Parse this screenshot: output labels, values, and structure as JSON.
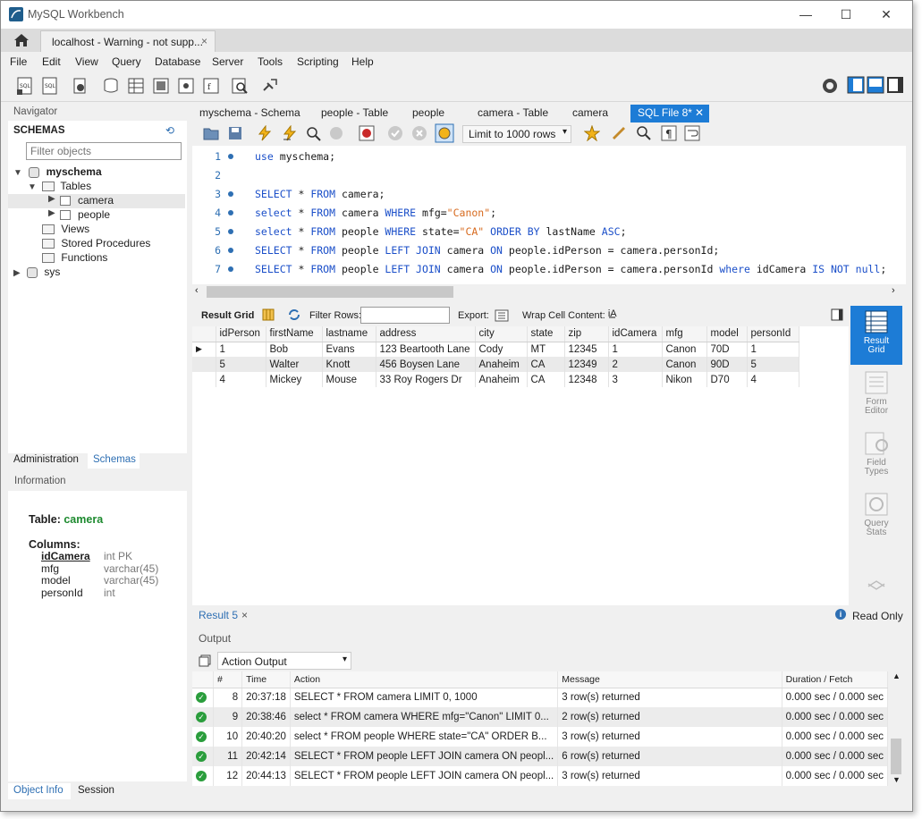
{
  "window": {
    "title": "MySQL Workbench"
  },
  "connection_tab": {
    "label": "localhost - Warning - not supp...",
    "close": "×"
  },
  "menu": [
    "File",
    "Edit",
    "View",
    "Query",
    "Database",
    "Server",
    "Tools",
    "Scripting",
    "Help"
  ],
  "navigator": {
    "title": "Navigator",
    "schemas_label": "SCHEMAS",
    "filter_placeholder": "Filter objects",
    "tree": {
      "schema": "myschema",
      "tables": "Tables",
      "table1": "camera",
      "table2": "people",
      "views": "Views",
      "procs": "Stored Procedures",
      "funcs": "Functions",
      "sys": "sys"
    },
    "tabs": [
      "Administration",
      "Schemas"
    ],
    "information_label": "Information"
  },
  "info": {
    "table_prefix": "Table: ",
    "table_name": "camera",
    "columns_label": "Columns:",
    "columns": [
      {
        "name": "idCamera",
        "type": "int PK"
      },
      {
        "name": "mfg",
        "type": "varchar(45)"
      },
      {
        "name": "model",
        "type": "varchar(45)"
      },
      {
        "name": "personId",
        "type": "int"
      }
    ]
  },
  "bottom_tabs": [
    "Object Info",
    "Session"
  ],
  "editor_tabs": [
    "myschema - Schema",
    "people - Table",
    "people",
    "camera - Table",
    "camera",
    "SQL File 8*"
  ],
  "editor": {
    "limit": "Limit to 1000 rows",
    "line_numbers": [
      "1",
      "2",
      "3",
      "4",
      "5",
      "6",
      "7"
    ]
  },
  "result_bar": {
    "result_grid": "Result Grid",
    "filter_rows": "Filter Rows:",
    "export": "Export:",
    "wrap": "Wrap Cell Content:"
  },
  "grid": {
    "columns": [
      "idPerson",
      "firstName",
      "lastname",
      "address",
      "city",
      "state",
      "zip",
      "idCamera",
      "mfg",
      "model",
      "personId"
    ],
    "rows": [
      [
        "1",
        "Bob",
        "Evans",
        "123 Beartooth Lane",
        "Cody",
        "MT",
        "12345",
        "1",
        "Canon",
        "70D",
        "1"
      ],
      [
        "5",
        "Walter",
        "Knott",
        "456 Boysen Lane",
        "Anaheim",
        "CA",
        "12349",
        "2",
        "Canon",
        "90D",
        "5"
      ],
      [
        "4",
        "Mickey",
        "Mouse",
        "33 Roy Rogers Dr",
        "Anaheim",
        "CA",
        "12348",
        "3",
        "Nikon",
        "D70",
        "4"
      ]
    ]
  },
  "side_panel": {
    "result_grid": [
      "Result",
      "Grid"
    ],
    "form_editor": [
      "Form",
      "Editor"
    ],
    "field_types": [
      "Field",
      "Types"
    ],
    "query_stats": [
      "Query",
      "Stats"
    ]
  },
  "result_tab": {
    "label": "Result 5",
    "close": "×",
    "read_only": "Read Only"
  },
  "output": {
    "title": "Output",
    "mode": "Action Output",
    "columns": [
      "#",
      "Time",
      "Action",
      "Message",
      "Duration / Fetch"
    ],
    "rows": [
      [
        "8",
        "20:37:18",
        "SELECT * FROM camera LIMIT 0, 1000",
        "3 row(s) returned",
        "0.000 sec / 0.000 sec"
      ],
      [
        "9",
        "20:38:46",
        "select * FROM camera WHERE mfg=\"Canon\" LIMIT 0...",
        "2 row(s) returned",
        "0.000 sec / 0.000 sec"
      ],
      [
        "10",
        "20:40:20",
        "select * FROM people WHERE state=\"CA\" ORDER B...",
        "3 row(s) returned",
        "0.000 sec / 0.000 sec"
      ],
      [
        "11",
        "20:42:14",
        "SELECT * FROM people LEFT JOIN camera ON peopl...",
        "6 row(s) returned",
        "0.000 sec / 0.000 sec"
      ],
      [
        "12",
        "20:44:13",
        "SELECT * FROM people LEFT JOIN camera ON peopl...",
        "3 row(s) returned",
        "0.000 sec / 0.000 sec"
      ]
    ]
  },
  "colors": {
    "accent": "#1d7cd6",
    "keyword": "#1b4fc9",
    "string": "#d76a1e",
    "ok": "#2a9d3c",
    "schema_green": "#1d8a2f"
  }
}
